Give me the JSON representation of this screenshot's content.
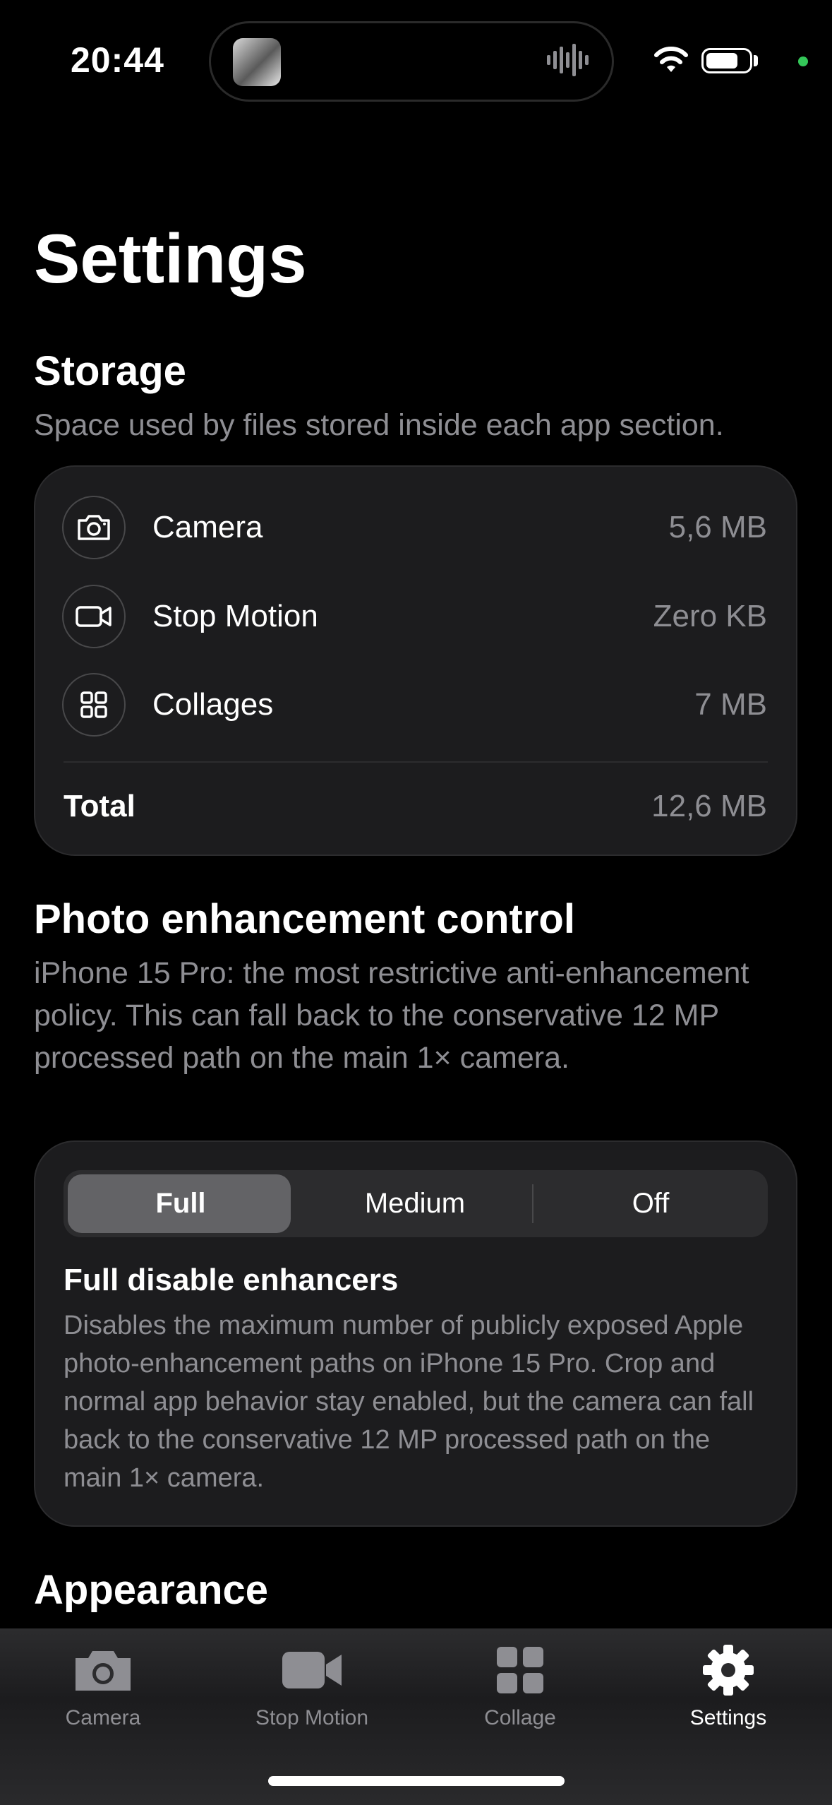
{
  "status_bar": {
    "time": "20:44",
    "recording_indicator_color": "#34c759"
  },
  "page_title": "Settings",
  "storage": {
    "title": "Storage",
    "description": "Space used by files stored inside each app section.",
    "items": [
      {
        "icon": "camera-icon",
        "label": "Camera",
        "value": "5,6 MB"
      },
      {
        "icon": "video-icon",
        "label": "Stop Motion",
        "value": "Zero KB"
      },
      {
        "icon": "grid-icon",
        "label": "Collages",
        "value": "7 MB"
      }
    ],
    "total_label": "Total",
    "total_value": "12,6 MB"
  },
  "enhancement": {
    "title": "Photo enhancement control",
    "description": "iPhone 15 Pro: the most restrictive anti-enhancement policy. This can fall back to the conservative 12 MP processed path on the main 1× camera.",
    "segments": [
      "Full",
      "Medium",
      "Off"
    ],
    "selected": "Full",
    "option_title": "Full disable enhancers",
    "option_description": "Disables the maximum number of publicly exposed Apple photo-enhancement paths on iPhone 15 Pro. Crop and normal app behavior stay enabled, but the camera can fall back to the conservative 12 MP processed path on the main 1× camera."
  },
  "appearance": {
    "title": "Appearance"
  },
  "tabbar": {
    "items": [
      {
        "icon": "camera-icon",
        "label": "Camera"
      },
      {
        "icon": "video-icon",
        "label": "Stop Motion"
      },
      {
        "icon": "grid-icon",
        "label": "Collage"
      },
      {
        "icon": "gear-icon",
        "label": "Settings"
      }
    ],
    "active": "Settings"
  }
}
